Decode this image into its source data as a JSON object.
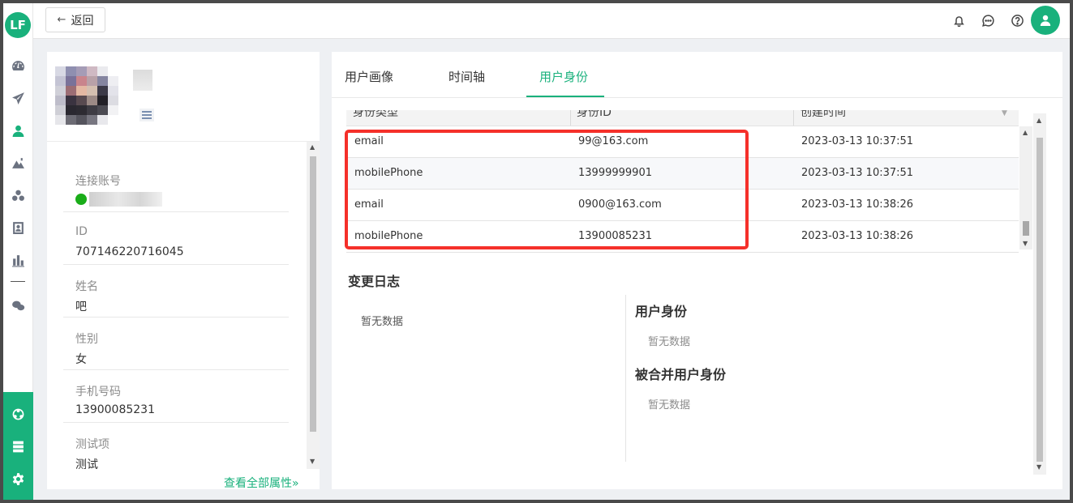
{
  "nav": {
    "logo": "LF",
    "items": [
      "dashboard-icon",
      "send-icon",
      "user-portrait-icon",
      "mountain-icon",
      "cluster-icon",
      "contact-icon",
      "bar-chart-icon",
      "wechat-icon"
    ],
    "bottom_items": [
      "network-icon",
      "server-icon",
      "gear-icon"
    ]
  },
  "topbar": {
    "back_label": "返回",
    "icons": [
      "bell-icon",
      "message-icon",
      "help-icon",
      "avatar-icon"
    ]
  },
  "profile": {
    "properties": [
      {
        "key": "连接账号",
        "value": ""
      },
      {
        "key": "ID",
        "value": "707146220716045"
      },
      {
        "key": "姓名",
        "value": "吧"
      },
      {
        "key": "性别",
        "value": "女"
      },
      {
        "key": "手机号码",
        "value": "13900085231"
      },
      {
        "key": "测试项",
        "value": "测试"
      }
    ],
    "view_all_label": "查看全部属性",
    "view_all_glyph": "»"
  },
  "tabs": [
    {
      "label": "用户画像",
      "active": false
    },
    {
      "label": "时间轴",
      "active": false
    },
    {
      "label": "用户身份",
      "active": true
    }
  ],
  "identity_table": {
    "columns": [
      "身份类型",
      "身份ID",
      "创建时间"
    ],
    "rows": [
      {
        "type": "email",
        "id": "99@163.com",
        "created": "2023-03-13 10:37:51"
      },
      {
        "type": "mobilePhone",
        "id": "13999999901",
        "created": "2023-03-13 10:37:51"
      },
      {
        "type": "email",
        "id": "0900@163.com",
        "created": "2023-03-13 10:38:26"
      },
      {
        "type": "mobilePhone",
        "id": "13900085231",
        "created": "2023-03-13 10:38:26"
      }
    ]
  },
  "change_log": {
    "title": "变更日志",
    "empty_left": "暂无数据",
    "user_identity_title": "用户身份",
    "user_identity_empty": "暂无数据",
    "merged_title": "被合并用户身份",
    "merged_empty": "暂无数据"
  },
  "colors": {
    "accent": "#19b17c",
    "highlight": "#f5302a"
  }
}
